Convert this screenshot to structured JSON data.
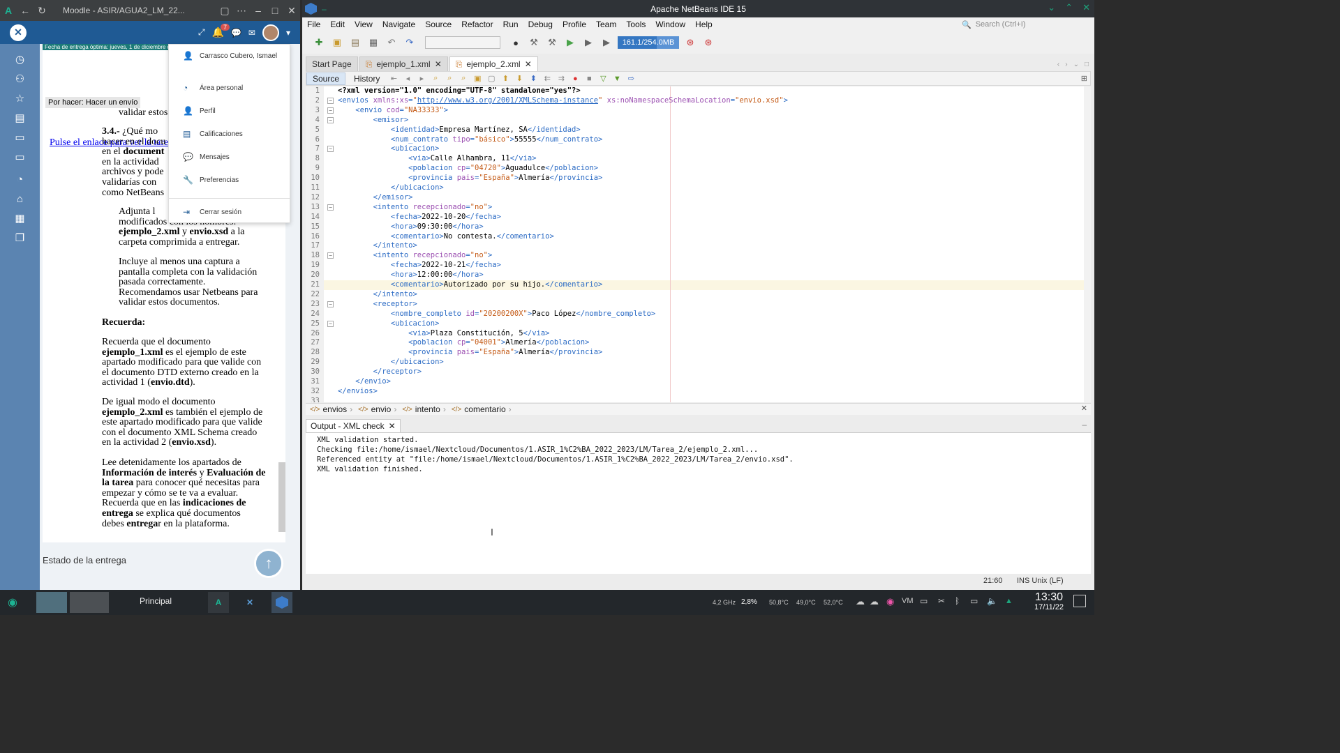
{
  "browser": {
    "title": "Moodle - ASIR/AGUA2_LM_22...",
    "nav_notif_count": "7",
    "due_label": "Fecha de entrega óptima: jueves, 1 de diciembre de...",
    "por_hacer": "Por hacer: Hacer un envío",
    "link_text": "Pulse el enlace para ver la tarea a...",
    "partial_top": "validar estos",
    "q34_lines": [
      "3.4.- ¿Qué mo",
      "hacer en el docu",
      "en el document",
      "en la actividad",
      "archivos y pode",
      "validarías con",
      "como NetBeans"
    ],
    "adjunta": [
      "Adjunta l",
      "modificados con los nombres:",
      "ejemplo_2.xml y envio.xsd a la",
      "carpeta comprimida a entregar."
    ],
    "incluye": [
      "Incluye al menos una captura a",
      "pantalla completa con la validación",
      "pasada correctamente.",
      "Recomendamos usar Netbeans para",
      "validar estos documentos."
    ],
    "recuerda_title": "Recuerda:",
    "recuerda1": [
      "Recuerda que el documento",
      "ejemplo_1.xml es el ejemplo de este",
      "apartado modificado para que valide con",
      "el documento DTD externo creado en la",
      "actividad 1 (envio.dtd)."
    ],
    "recuerda2": [
      "De igual modo el documento",
      "ejemplo_2.xml es también el ejemplo de",
      "este apartado modificado para que valide",
      "con el documento XML Schema creado",
      "en la actividad 2 (envio.xsd)."
    ],
    "recuerda3": [
      "Lee detenidamente los apartados de",
      "Información de interés y Evaluación de",
      "la tarea para conocer qué necesitas para",
      "empezar y cómo se te va a evaluar.",
      "Recuerda que en las indicaciones de",
      "entrega se explica qué documentos",
      "debes entregar en la plataforma."
    ],
    "estado": "Estado de la entrega"
  },
  "user_menu": {
    "name": "Carrasco Cubero, Ismael",
    "items": [
      "Área personal",
      "Perfil",
      "Calificaciones",
      "Mensajes",
      "Preferencias"
    ],
    "logout": "Cerrar sesión"
  },
  "netbeans": {
    "title": "Apache NetBeans IDE 15",
    "menus": [
      "File",
      "Edit",
      "View",
      "Navigate",
      "Source",
      "Refactor",
      "Run",
      "Debug",
      "Profile",
      "Team",
      "Tools",
      "Window",
      "Help"
    ],
    "search_placeholder": "Search (Ctrl+I)",
    "memory": "161.1/254.0MB",
    "memory_fraction": 0.634,
    "tabs": [
      "Start Page",
      "ejemplo_1.xml",
      "ejemplo_2.xml"
    ],
    "active_tab": 2,
    "editor_tabs": [
      "Source",
      "History"
    ],
    "breadcrumb": [
      "envios",
      "envio",
      "intento",
      "comentario"
    ],
    "output_tab": "Output - XML check",
    "output_lines": [
      "XML validation started.",
      "Checking file:/home/ismael/Nextcloud/Documentos/1.ASIR_1%C2%BA_2022_2023/LM/Tarea_2/ejemplo_2.xml...",
      "Referenced entity at \"file:/home/ismael/Nextcloud/Documentos/1.ASIR_1%C2%BA_2022_2023/LM/Tarea_2/envio.xsd\".",
      "XML validation finished."
    ],
    "caret_pos": "21:60",
    "ins": "INS",
    "eol": "Unix (LF)"
  },
  "code_lines": [
    "<?xml version=\"1.0\" encoding=\"UTF-8\" standalone=\"yes\"?>",
    "<envios xmlns:xs=\"http://www.w3.org/2001/XMLSchema-instance\" xs:noNamespaceSchemaLocation=\"envio.xsd\">",
    "    <envio cod=\"NA33333\">",
    "        <emisor>",
    "            <identidad>Empresa Martínez, SA</identidad>",
    "            <num_contrato tipo=\"básico\">55555</num_contrato>",
    "            <ubicacion>",
    "                <via>Calle Alhambra, 11</via>",
    "                <poblacion cp=\"04720\">Aguadulce</poblacion>",
    "                <provincia pais=\"España\">Almería</provincia>",
    "            </ubicacion>",
    "        </emisor>",
    "        <intento recepcionado=\"no\">",
    "            <fecha>2022-10-20</fecha>",
    "            <hora>09:30:00</hora>",
    "            <comentario>No contesta.</comentario>",
    "        </intento>",
    "        <intento recepcionado=\"no\">",
    "            <fecha>2022-10-21</fecha>",
    "            <hora>12:00:00</hora>",
    "            <comentario>Autorizado por su hijo.</comentario>",
    "        </intento>",
    "        <receptor>",
    "            <nombre_completo id=\"20200200X\">Paco López</nombre_completo>",
    "            <ubicacion>",
    "                <via>Plaza Constitución, 5</via>",
    "                <poblacion cp=\"04001\">Almería</poblacion>",
    "                <provincia pais=\"España\">Almería</provincia>",
    "            </ubicacion>",
    "        </receptor>",
    "    </envio>",
    "</envios>",
    ""
  ],
  "fold_lines": [
    2,
    3,
    4,
    7,
    13,
    18,
    23,
    25
  ],
  "highlight_line": 21,
  "taskbar": {
    "principal": "Principal",
    "tray": [
      "4,2 GHz",
      "2,8%",
      "50,8°C",
      "49,0°C",
      "52,0°C"
    ],
    "time": "13:30",
    "date": "17/11/22"
  }
}
